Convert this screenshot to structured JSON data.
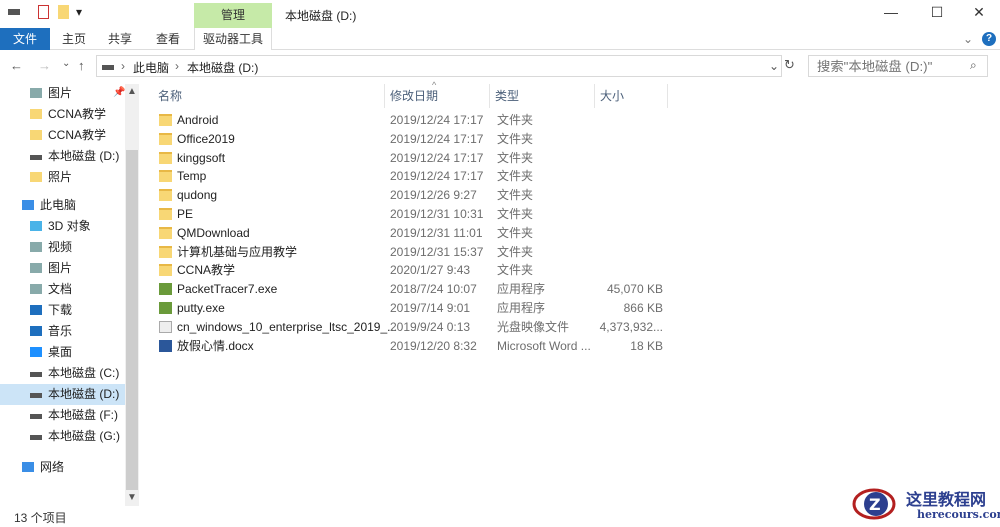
{
  "window": {
    "title": "本地磁盘 (D:)",
    "context_tab": "管理",
    "minimize": "—",
    "maximize": "☐",
    "close": "✕"
  },
  "ribbon": {
    "tabs": [
      "文件",
      "主页",
      "共享",
      "查看"
    ],
    "drive_tools": "驱动器工具",
    "collapse": "⌄",
    "help": "?"
  },
  "address": {
    "back": "←",
    "forward": "→",
    "recent": "⌄",
    "up": "↑",
    "crumbs": [
      "此电脑",
      "本地磁盘 (D:)"
    ],
    "sep": "›",
    "dropdown": "⌄",
    "refresh": "↻"
  },
  "search": {
    "placeholder": "搜索\"本地磁盘 (D:)\""
  },
  "sidebar": [
    {
      "label": "图片",
      "icon": "pictures-icon",
      "pinned": true
    },
    {
      "label": "CCNA教学",
      "icon": "folder-icon"
    },
    {
      "label": "CCNA教学",
      "icon": "folder-icon"
    },
    {
      "label": "本地磁盘 (D:)",
      "icon": "drive-icon"
    },
    {
      "label": "照片",
      "icon": "folder-icon"
    },
    {
      "label": "此电脑",
      "icon": "pc-icon",
      "top": true
    },
    {
      "label": "3D 对象",
      "icon": "3d-objects-icon"
    },
    {
      "label": "视频",
      "icon": "video-icon"
    },
    {
      "label": "图片",
      "icon": "pictures-icon"
    },
    {
      "label": "文档",
      "icon": "documents-icon"
    },
    {
      "label": "下载",
      "icon": "download-icon"
    },
    {
      "label": "音乐",
      "icon": "music-icon"
    },
    {
      "label": "桌面",
      "icon": "desktop-icon"
    },
    {
      "label": "本地磁盘 (C:)",
      "icon": "drive-icon"
    },
    {
      "label": "本地磁盘 (D:)",
      "icon": "drive-icon",
      "selected": true
    },
    {
      "label": "本地磁盘 (F:)",
      "icon": "drive-icon"
    },
    {
      "label": "本地磁盘 (G:)",
      "icon": "drive-icon"
    },
    {
      "label": "网络",
      "icon": "network-icon",
      "top": true
    }
  ],
  "columns": {
    "name": "名称",
    "date": "修改日期",
    "type": "类型",
    "size": "大小"
  },
  "files": [
    {
      "name": "Android",
      "date": "2019/12/24 17:17",
      "type": "文件夹",
      "size": "",
      "icon": "folder"
    },
    {
      "name": "Office2019",
      "date": "2019/12/24 17:17",
      "type": "文件夹",
      "size": "",
      "icon": "folder"
    },
    {
      "name": "kinggsoft",
      "date": "2019/12/24 17:17",
      "type": "文件夹",
      "size": "",
      "icon": "folder"
    },
    {
      "name": "Temp",
      "date": "2019/12/24 17:17",
      "type": "文件夹",
      "size": "",
      "icon": "folder"
    },
    {
      "name": "qudong",
      "date": "2019/12/26 9:27",
      "type": "文件夹",
      "size": "",
      "icon": "folder"
    },
    {
      "name": "PE",
      "date": "2019/12/31 10:31",
      "type": "文件夹",
      "size": "",
      "icon": "folder"
    },
    {
      "name": "QMDownload",
      "date": "2019/12/31 11:01",
      "type": "文件夹",
      "size": "",
      "icon": "folder"
    },
    {
      "name": "计算机基础与应用教学",
      "date": "2019/12/31 15:37",
      "type": "文件夹",
      "size": "",
      "icon": "folder"
    },
    {
      "name": "CCNA教学",
      "date": "2020/1/27 9:43",
      "type": "文件夹",
      "size": "",
      "icon": "folder"
    },
    {
      "name": "PacketTracer7.exe",
      "date": "2018/7/24 10:07",
      "type": "应用程序",
      "size": "45,070 KB",
      "icon": "exe"
    },
    {
      "name": "putty.exe",
      "date": "2019/7/14 9:01",
      "type": "应用程序",
      "size": "866 KB",
      "icon": "exe"
    },
    {
      "name": "cn_windows_10_enterprise_ltsc_2019_...",
      "date": "2019/9/24 0:13",
      "type": "光盘映像文件",
      "size": "4,373,932...",
      "icon": "iso"
    },
    {
      "name": "放假心情.docx",
      "date": "2019/12/20 8:32",
      "type": "Microsoft Word ...",
      "size": "18 KB",
      "icon": "docx"
    }
  ],
  "status": {
    "count": "13 个项目"
  },
  "watermark": {
    "title": "这里教程网",
    "url": "herecours.com"
  }
}
